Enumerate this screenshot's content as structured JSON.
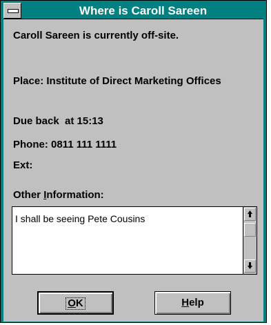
{
  "window": {
    "title": "Where is Caroll Sareen"
  },
  "status": {
    "summary": "Caroll Sareen is currently off-site."
  },
  "details": {
    "place": "Place: Institute of Direct Marketing Offices",
    "due_back": "Due back  at 15:13",
    "phone": "Phone: 0811 111 1111",
    "ext": "Ext:"
  },
  "other_info": {
    "label_pre": "Other ",
    "label_hotkey": "I",
    "label_post": "nformation:",
    "text": "I shall be seeing Pete Cousins"
  },
  "buttons": {
    "ok_hotkey": "O",
    "ok_rest": "K",
    "help_hotkey": "H",
    "help_rest": "elp"
  },
  "icons": {
    "system_menu": "system-menu-icon",
    "scroll_up": "up-arrow-icon",
    "scroll_down": "down-arrow-icon"
  },
  "colors": {
    "title_bar": "#008080",
    "face": "#c0c0c0"
  }
}
